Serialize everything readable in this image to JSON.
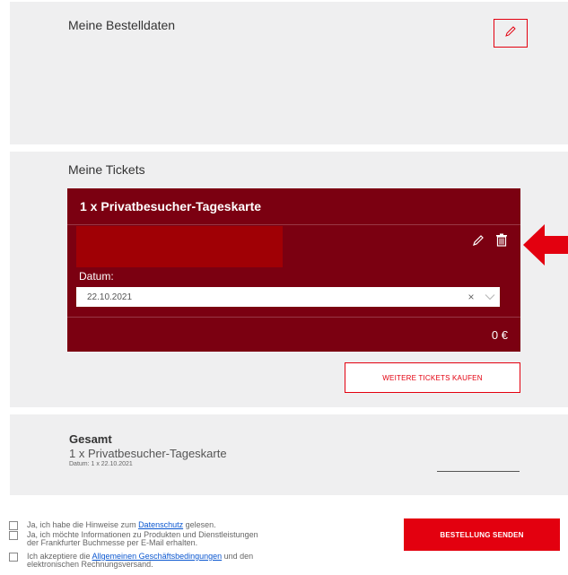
{
  "order_data": {
    "title": "Meine Bestelldaten"
  },
  "tickets": {
    "title": "Meine Tickets",
    "card": {
      "title": "1 x Privatbesucher-Tageskarte",
      "date_label": "Datum:",
      "date_value": "22.10.2021",
      "clear_symbol": "×",
      "price": "0 €"
    },
    "more_button": "WEITERE TICKETS KAUFEN"
  },
  "summary": {
    "title": "Gesamt",
    "item": "1 x Privatbesucher-Tageskarte",
    "date_detail": "Datum: 1 x 22.10.2021"
  },
  "consents": {
    "privacy": {
      "before": "Ja, ich habe die Hinweise zum ",
      "link": "Datenschutz",
      "after": " gelesen."
    },
    "newsletter": {
      "line1": "Ja, ich möchte Informationen zu Produkten und Dienstleistungen",
      "line2": "der Frankfurter Buchmesse per E-Mail erhalten."
    },
    "terms": {
      "before": "Ich akzeptiere die ",
      "link": "Allgemeinen Geschäftsbedingungen",
      "after": " und den",
      "line2": "elektronischen Rechnungsversand."
    }
  },
  "send_button": "BESTELLUNG SENDEN",
  "colors": {
    "accent": "#e3000f",
    "ticket_card": "#7b0011",
    "redaction": "#a00005",
    "panel_bg": "#efeff0"
  },
  "icons": [
    "pencil-icon",
    "trash-icon",
    "chevron-down-icon",
    "clear-icon",
    "arrow-left-icon"
  ]
}
